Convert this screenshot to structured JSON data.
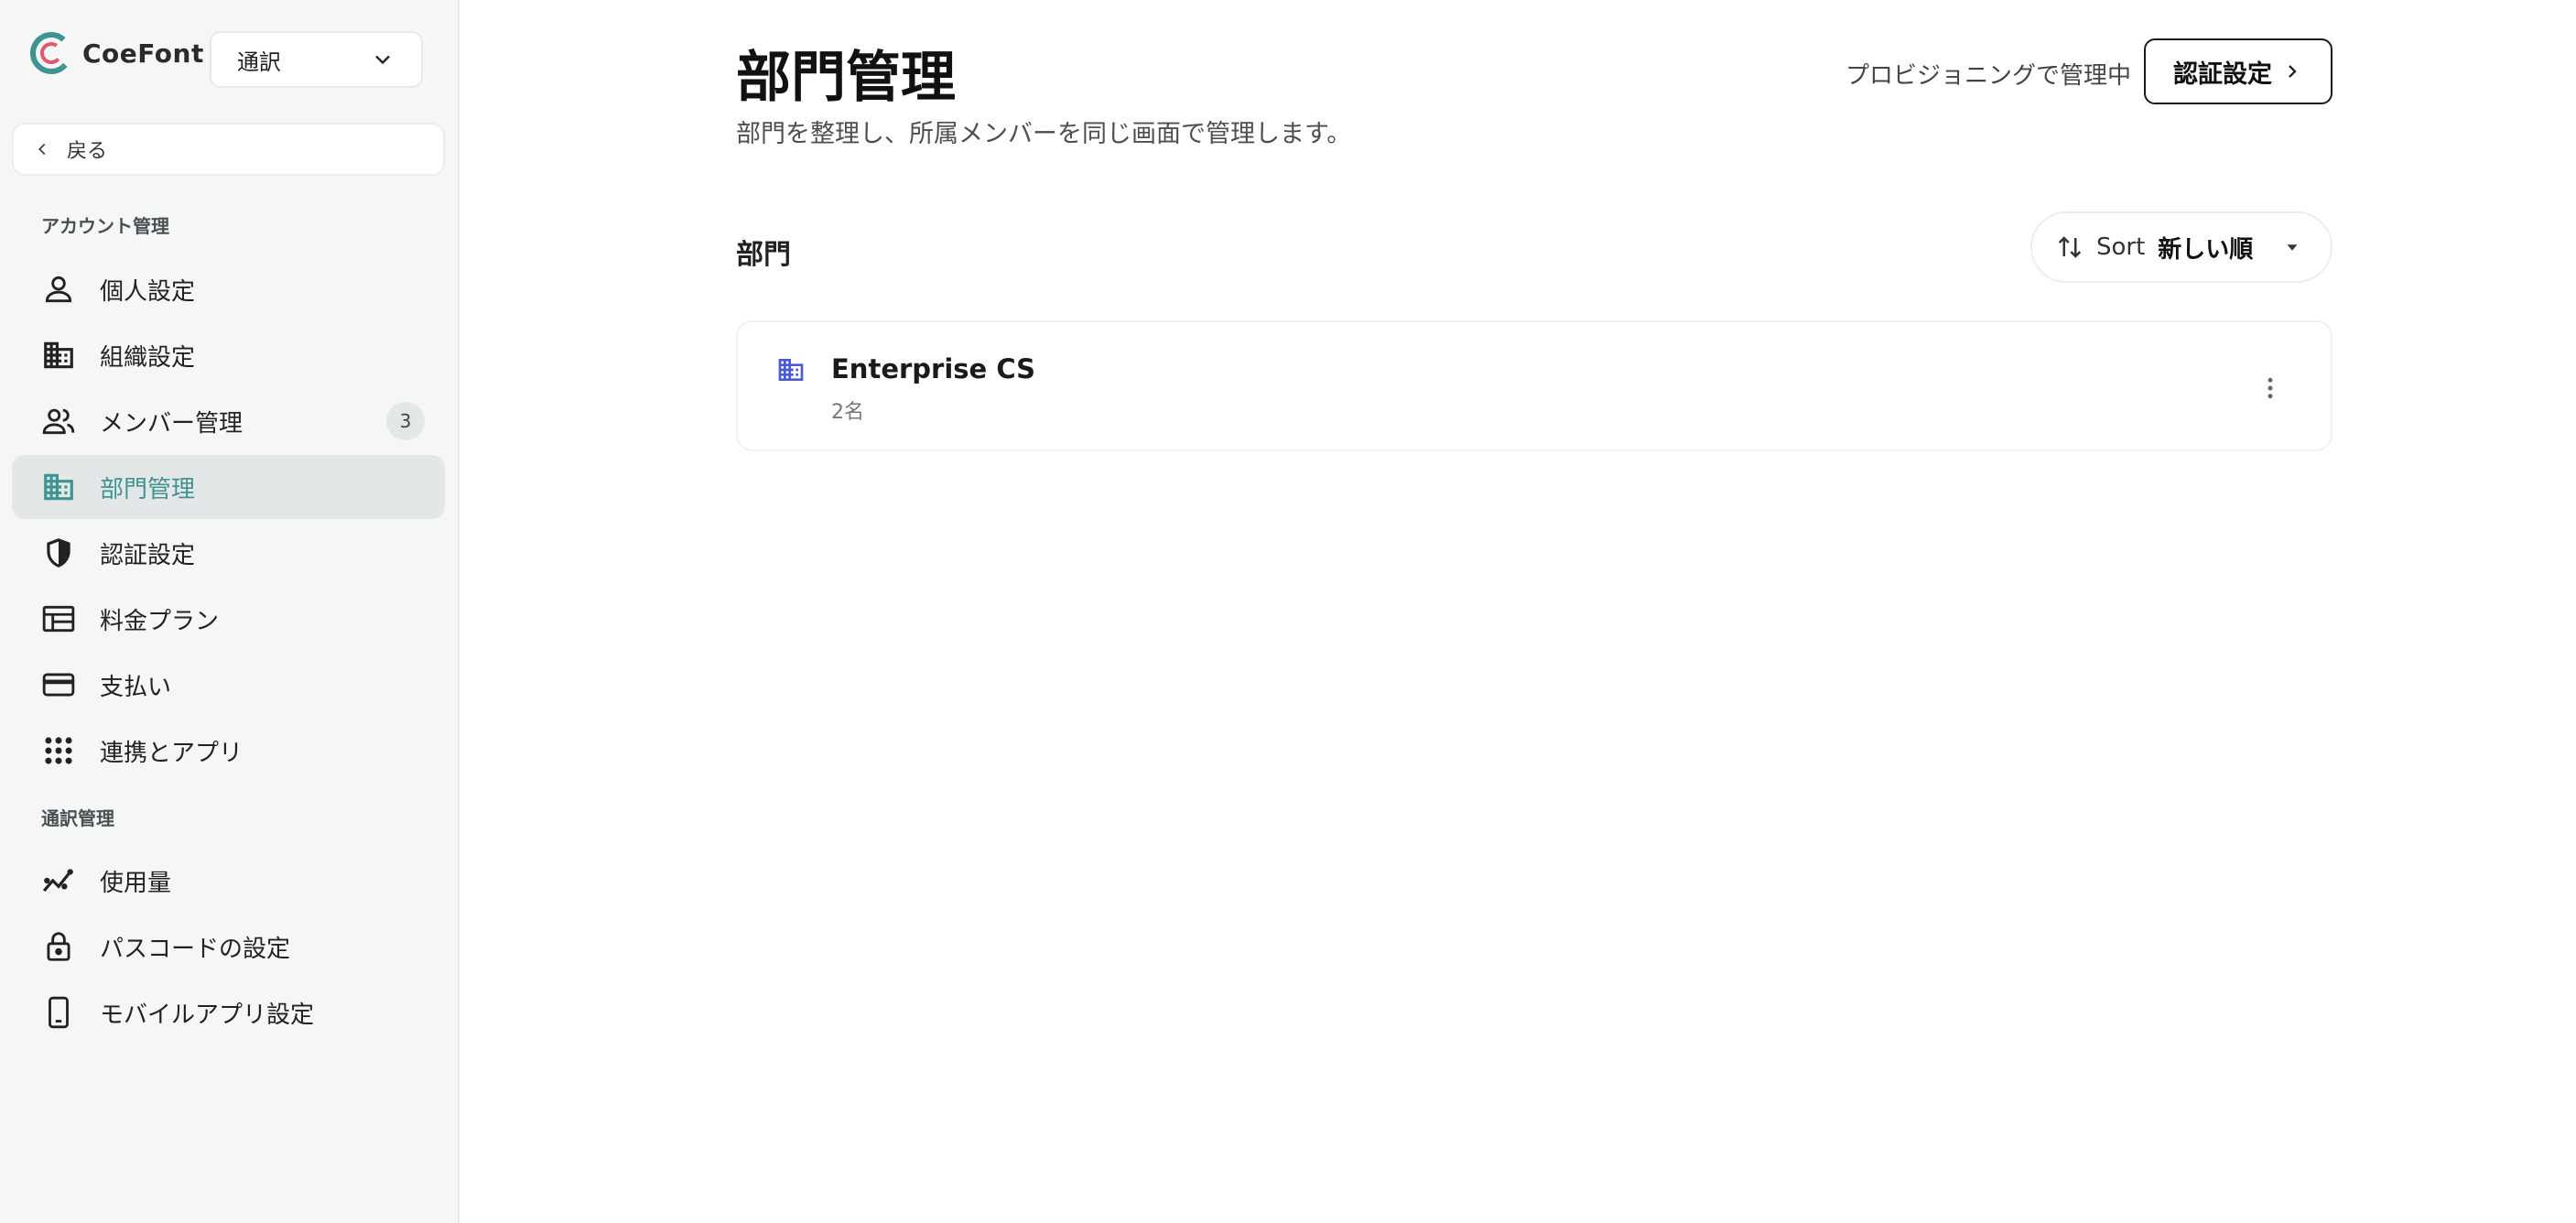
{
  "brand": {
    "name": "CoeFont",
    "accent": "#3f9390"
  },
  "product_select": {
    "value": "通訳"
  },
  "back": {
    "label": "戻る"
  },
  "sidebar": {
    "account_section": "アカウント管理",
    "interpret_section": "通訳管理",
    "items": [
      {
        "label": "個人設定",
        "icon": "person-icon"
      },
      {
        "label": "組織設定",
        "icon": "building-icon"
      },
      {
        "label": "メンバー管理",
        "icon": "people-icon",
        "badge": "3"
      },
      {
        "label": "部門管理",
        "icon": "department-icon",
        "active": true
      },
      {
        "label": "認証設定",
        "icon": "shield-icon"
      },
      {
        "label": "料金プラン",
        "icon": "plan-icon"
      },
      {
        "label": "支払い",
        "icon": "credit-card-icon"
      },
      {
        "label": "連携とアプリ",
        "icon": "grid-icon"
      },
      {
        "label": "使用量",
        "icon": "usage-chart-icon"
      },
      {
        "label": "パスコードの設定",
        "icon": "lock-icon"
      },
      {
        "label": "モバイルアプリ設定",
        "icon": "phone-icon"
      }
    ]
  },
  "header": {
    "title": "部門管理",
    "subtitle": "部門を整理し、所属メンバーを同じ画面で管理します。",
    "provision_text": "プロビジョニングで管理中",
    "auth_button": "認証設定"
  },
  "departments_section": {
    "title": "部門",
    "sort_label": "Sort",
    "sort_value": "新しい順"
  },
  "departments": [
    {
      "name": "Enterprise CS",
      "count": "2名"
    }
  ]
}
